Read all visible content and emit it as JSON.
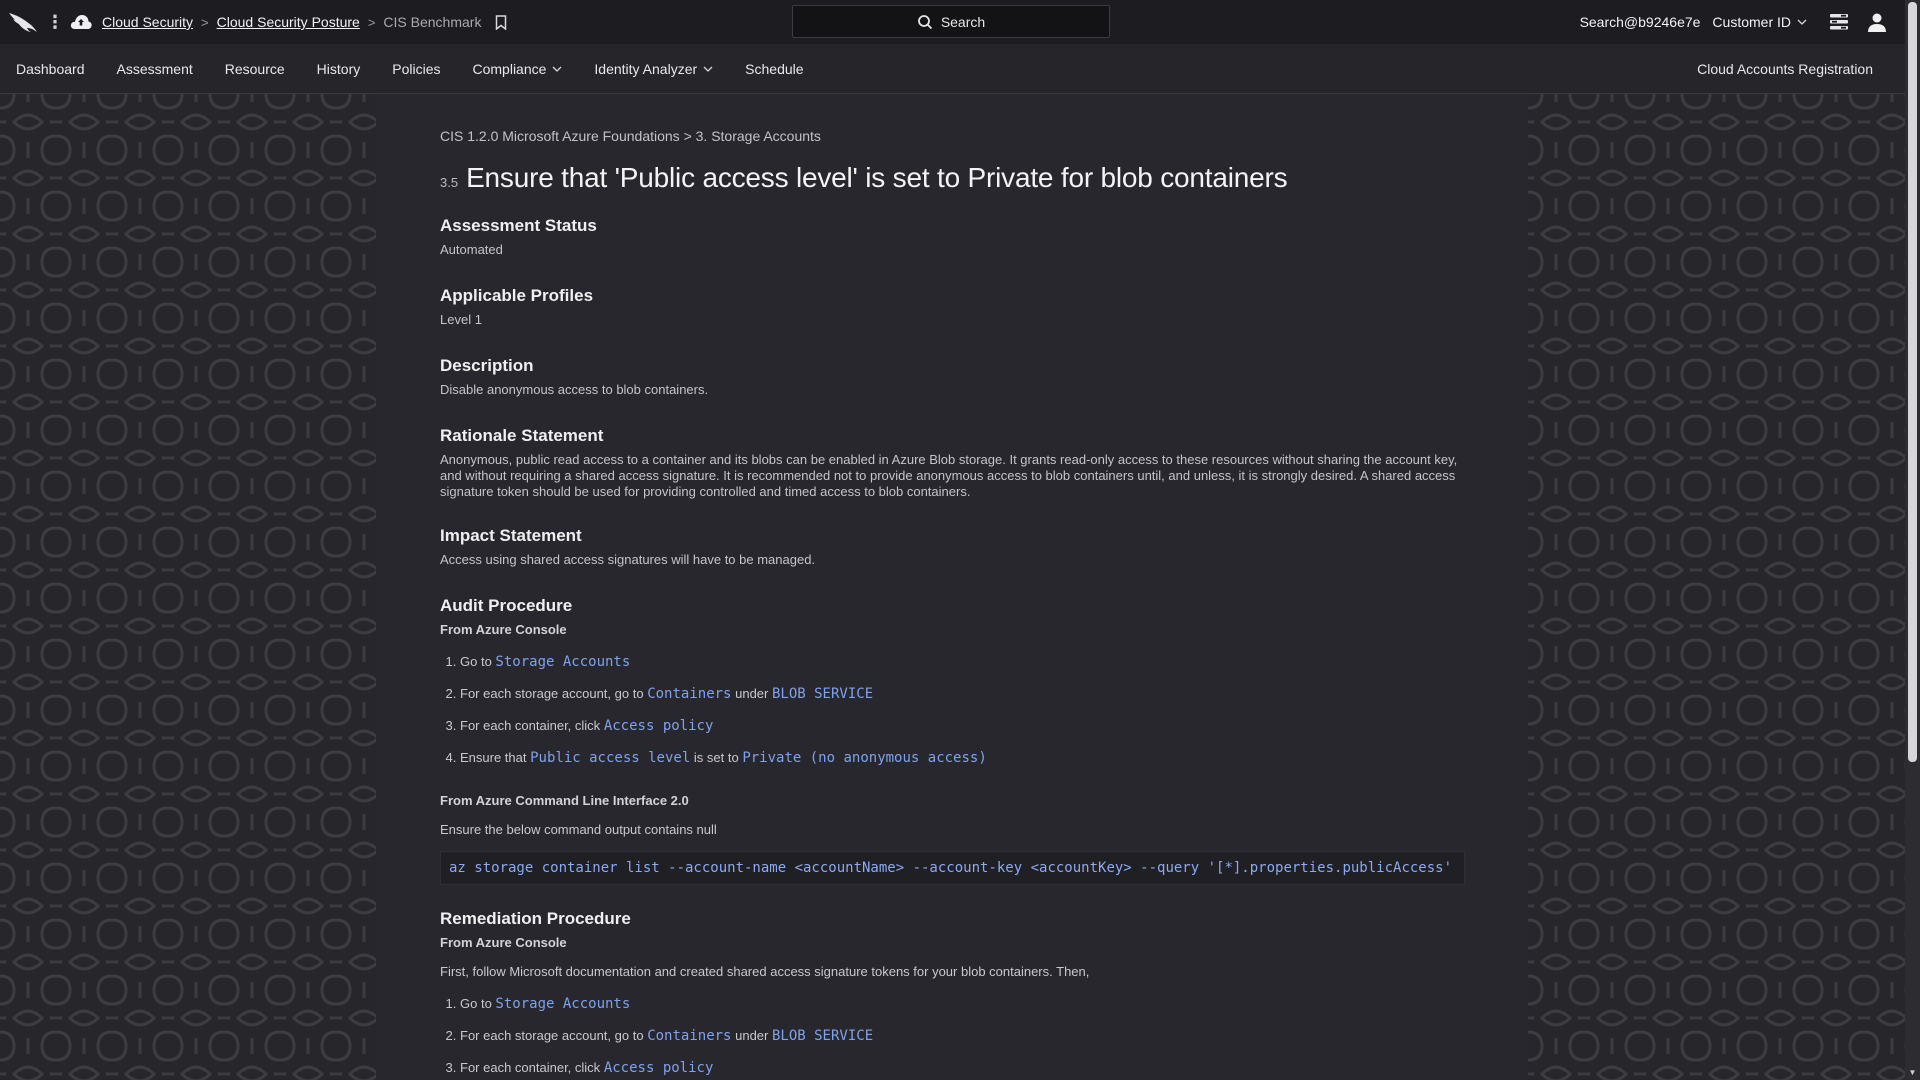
{
  "topbar": {
    "breadcrumbs": [
      {
        "label": "Cloud Security",
        "link": true
      },
      {
        "label": "Cloud Security Posture",
        "link": true
      },
      {
        "label": "CIS Benchmark",
        "link": false
      }
    ],
    "search_label": "Search",
    "user_search": "Search@b9246e7e",
    "customer_label": "Customer ID"
  },
  "nav": {
    "items": [
      {
        "label": "Dashboard",
        "dropdown": false
      },
      {
        "label": "Assessment",
        "dropdown": false
      },
      {
        "label": "Resource",
        "dropdown": false
      },
      {
        "label": "History",
        "dropdown": false
      },
      {
        "label": "Policies",
        "dropdown": false
      },
      {
        "label": "Compliance",
        "dropdown": true
      },
      {
        "label": "Identity Analyzer",
        "dropdown": true
      },
      {
        "label": "Schedule",
        "dropdown": false
      }
    ],
    "right_link": "Cloud Accounts Registration"
  },
  "doc": {
    "breadcrumb": "CIS 1.2.0 Microsoft Azure Foundations > 3. Storage Accounts",
    "number": "3.5",
    "title": "Ensure that 'Public access level' is set to Private for blob containers",
    "assessment_status": {
      "heading": "Assessment Status",
      "text": "Automated"
    },
    "profiles": {
      "heading": "Applicable Profiles",
      "text": "Level 1"
    },
    "description": {
      "heading": "Description",
      "text": "Disable anonymous access to blob containers."
    },
    "rationale": {
      "heading": "Rationale Statement",
      "text": "Anonymous, public read access to a container and its blobs can be enabled in Azure Blob storage. It grants read-only access to these resources without sharing the account key, and without requiring a shared access signature. It is recommended not to provide anonymous access to blob containers until, and unless, it is strongly desired. A shared access signature token should be used for providing controlled and timed access to blob containers."
    },
    "impact": {
      "heading": "Impact Statement",
      "text": "Access using shared access signatures will have to be managed."
    },
    "audit": {
      "heading": "Audit Procedure",
      "console_sub": "From Azure Console",
      "steps": [
        {
          "t1": "Go to",
          "c1": "Storage Accounts"
        },
        {
          "t1": "For each storage account, go to",
          "c1": "Containers",
          "t2": "under",
          "c2": "BLOB SERVICE"
        },
        {
          "t1": "For each container, click",
          "c1": "Access policy"
        },
        {
          "t1": "Ensure that",
          "c1": "Public access level",
          "t2": "is set to",
          "c2": "Private (no anonymous access)"
        }
      ],
      "cli_sub": "From Azure Command Line Interface 2.0",
      "cli_text": "Ensure the below command output contains null",
      "command": "az storage container list --account-name <accountName> --account-key <accountKey> --query '[*].properties.publicAccess'"
    },
    "remediation": {
      "heading": "Remediation Procedure",
      "console_sub": "From Azure Console",
      "intro": "First, follow Microsoft documentation and created shared access signature tokens for your blob containers. Then,",
      "steps": [
        {
          "t1": "Go to",
          "c1": "Storage Accounts"
        },
        {
          "t1": "For each storage account, go to",
          "c1": "Containers",
          "t2": "under",
          "c2": "BLOB SERVICE"
        },
        {
          "t1": "For each container, click",
          "c1": "Access policy"
        }
      ]
    }
  }
}
